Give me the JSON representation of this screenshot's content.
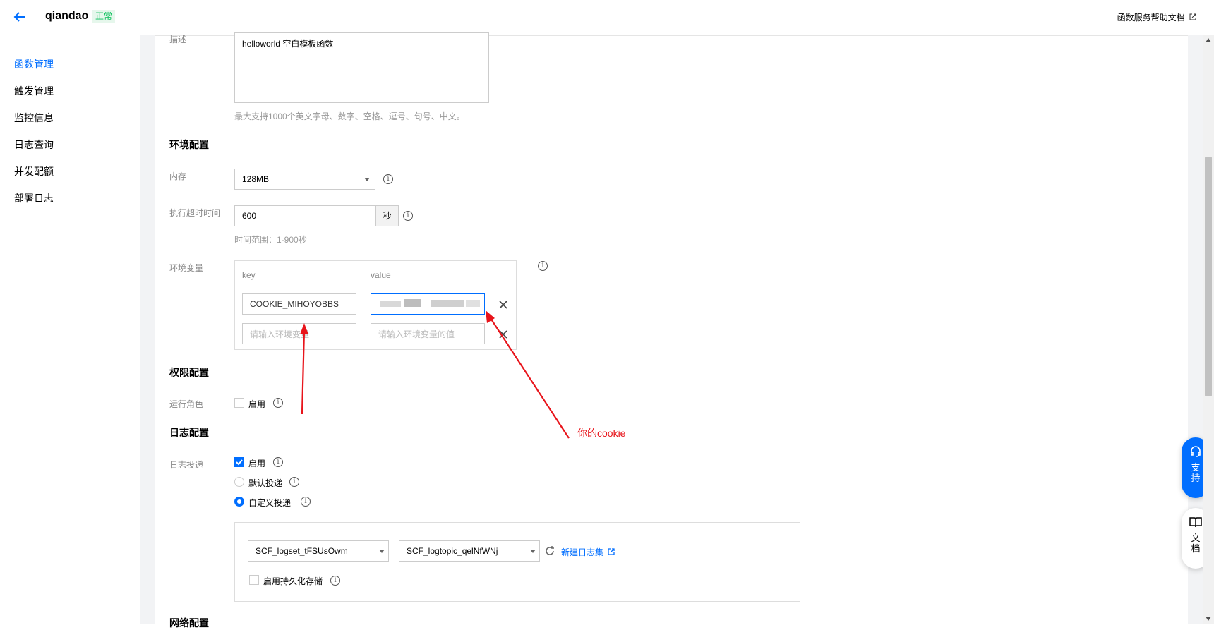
{
  "header": {
    "title": "qiandao",
    "status": "正常",
    "help_link": "函数服务帮助文档"
  },
  "sidebar": {
    "items": [
      {
        "label": "函数管理",
        "active": true
      },
      {
        "label": "触发管理"
      },
      {
        "label": "监控信息"
      },
      {
        "label": "日志查询"
      },
      {
        "label": "并发配额"
      },
      {
        "label": "部署日志"
      }
    ]
  },
  "description": {
    "label": "描述",
    "value": "helloworld 空白模板函数",
    "hint": "最大支持1000个英文字母、数字、空格、逗号、句号、中文。"
  },
  "env_config": {
    "title": "环境配置",
    "memory_label": "内存",
    "memory_value": "128MB",
    "timeout_label": "执行超时时间",
    "timeout_value": "600",
    "timeout_unit": "秒",
    "timeout_hint": "时间范围：1-900秒",
    "vars_label": "环境变量",
    "col_key": "key",
    "col_value": "value",
    "var_key": "COOKIE_MIHOYOBBS",
    "key_placeholder": "请输入环境变量",
    "value_placeholder": "请输入环境变量的值"
  },
  "permission": {
    "title": "权限配置",
    "role_label": "运行角色",
    "enable_label": "启用"
  },
  "log_config": {
    "title": "日志配置",
    "delivery_label": "日志投递",
    "enable_label": "启用",
    "default_label": "默认投递",
    "custom_label": "自定义投递",
    "logset": "SCF_logset_tFSUsOwm",
    "logtopic": "SCF_logtopic_qelNfWNj",
    "new_logset": "新建日志集",
    "persist_label": "启用持久化存储"
  },
  "network": {
    "title": "网络配置"
  },
  "annotation": {
    "text": "你的cookie",
    "color": "#e8141b"
  },
  "float_buttons": {
    "support": "支持",
    "docs": "文档"
  },
  "colors": {
    "accent": "#006eff",
    "success": "#0abf5b",
    "annotation": "#e8141b"
  }
}
